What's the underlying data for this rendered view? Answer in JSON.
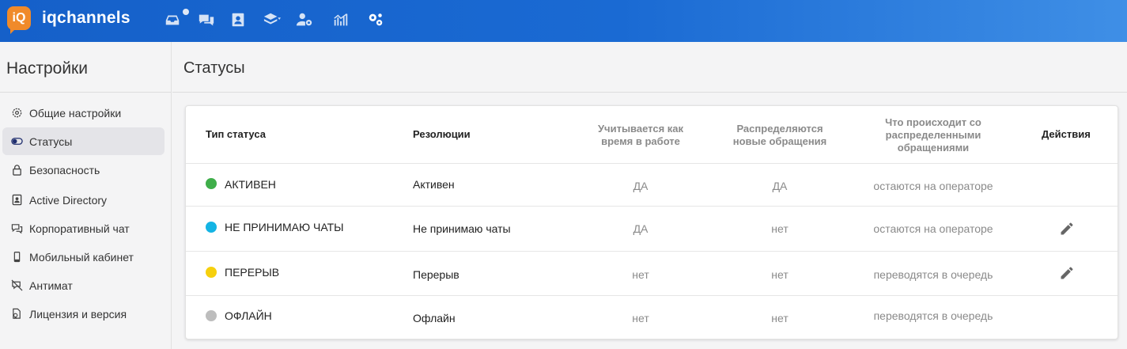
{
  "app": {
    "logo_text": "iQ",
    "brand": "iqchannels"
  },
  "topnav": [
    "inbox-icon",
    "chats-icon",
    "contacts-icon",
    "layers-icon",
    "users-settings-icon",
    "analytics-icon",
    "settings-icon"
  ],
  "sidebar": {
    "title": "Настройки",
    "items": [
      {
        "label": "Общие настройки",
        "icon": "gear-icon"
      },
      {
        "label": "Статусы",
        "icon": "toggle-icon",
        "active": true
      },
      {
        "label": "Безопасность",
        "icon": "lock-icon"
      },
      {
        "label": "Active Directory",
        "icon": "contact-book-icon"
      },
      {
        "label": "Корпоративный чат",
        "icon": "chat-icon"
      },
      {
        "label": "Мобильный кабинет",
        "icon": "mobile-icon"
      },
      {
        "label": "Антимат",
        "icon": "antimat-icon"
      },
      {
        "label": "Лицензия и версия",
        "icon": "license-icon"
      }
    ]
  },
  "main": {
    "title": "Статусы"
  },
  "table": {
    "headers": {
      "type": "Тип статуса",
      "resolutions": "Резолюции",
      "work_time": [
        "Учитывается как",
        "время в работе"
      ],
      "distributed": [
        "Распределяются",
        "новые обращения"
      ],
      "what_happens": [
        "Что происходит со",
        "распределенными",
        "обращениями"
      ],
      "actions": "Действия"
    },
    "rows": [
      {
        "status": "АКТИВЕН",
        "color": "#3fae4a",
        "resolution": "Активен",
        "work_time": "ДА",
        "distributed": "ДА",
        "what_happens": "остаются на операторе",
        "editable": false
      },
      {
        "status": "НЕ ПРИНИМАЮ ЧАТЫ",
        "color": "#14b4e4",
        "resolution": "Не принимаю чаты",
        "work_time": "ДА",
        "distributed": "нет",
        "what_happens": "остаются на операторе",
        "editable": true
      },
      {
        "status": "ПЕРЕРЫВ",
        "color": "#f6d00e",
        "resolution": "Перерыв",
        "work_time": "нет",
        "distributed": "нет",
        "what_happens": "переводятся в очередь",
        "editable": true
      },
      {
        "status": "ОФЛАЙН",
        "color": "#bdbdbd",
        "resolution": "Офлайн",
        "work_time": "нет",
        "distributed": "нет",
        "what_happens": "переводятся в очередь",
        "editable": false
      }
    ]
  }
}
